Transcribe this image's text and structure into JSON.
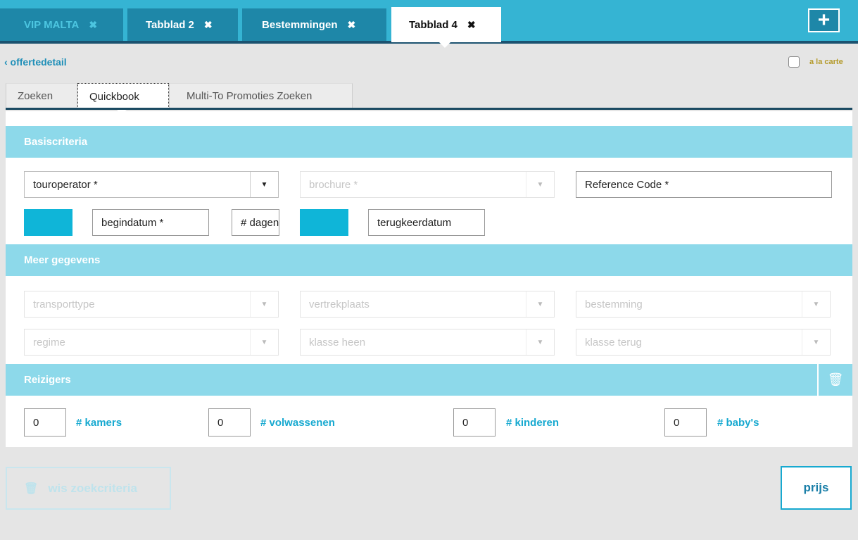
{
  "tabs": [
    {
      "label": "VIP MALTA",
      "close": "✖"
    },
    {
      "label": "Tabblad 2",
      "close": "✖"
    },
    {
      "label": "Bestemmingen",
      "close": "✖"
    },
    {
      "label": "Tabblad 4",
      "close": "✖"
    }
  ],
  "add_tab": "+",
  "back_label": "‹ offertedetail",
  "alacarte_label": "a la carte",
  "subtabs": [
    "Zoeken",
    "Quickbook",
    "Multi-To Promoties Zoeken"
  ],
  "sections": {
    "basis": "Basiscriteria",
    "meer": "Meer gegevens",
    "reizigers": "Reizigers"
  },
  "basis": {
    "touroperator": "touroperator *",
    "brochure": "brochure *",
    "reference": "Reference Code *",
    "begindatum": "begindatum *",
    "dagen": "# dagen",
    "terugkeerdatum": "terugkeerdatum"
  },
  "meer": {
    "transporttype": "transporttype",
    "vertrekplaats": "vertrekplaats",
    "bestemming": "bestemming",
    "regime": "regime",
    "klasse_heen": "klasse heen",
    "klasse_terug": "klasse terug"
  },
  "reizigers": {
    "kamers": {
      "value": "0",
      "label": "# kamers"
    },
    "volwassenen": {
      "value": "0",
      "label": "# volwassenen"
    },
    "kinderen": {
      "value": "0",
      "label": "# kinderen"
    },
    "babys": {
      "value": "0",
      "label": "# baby's"
    }
  },
  "buttons": {
    "wis": "wis zoekcriteria",
    "prijs": "prijs"
  },
  "icons": {
    "dropdown": "▼",
    "trash": "🗑"
  },
  "colors": {
    "accent": "#35b4d3",
    "section": "#8dd9ea",
    "label": "#17a9d0",
    "dark": "#1b4a62"
  }
}
